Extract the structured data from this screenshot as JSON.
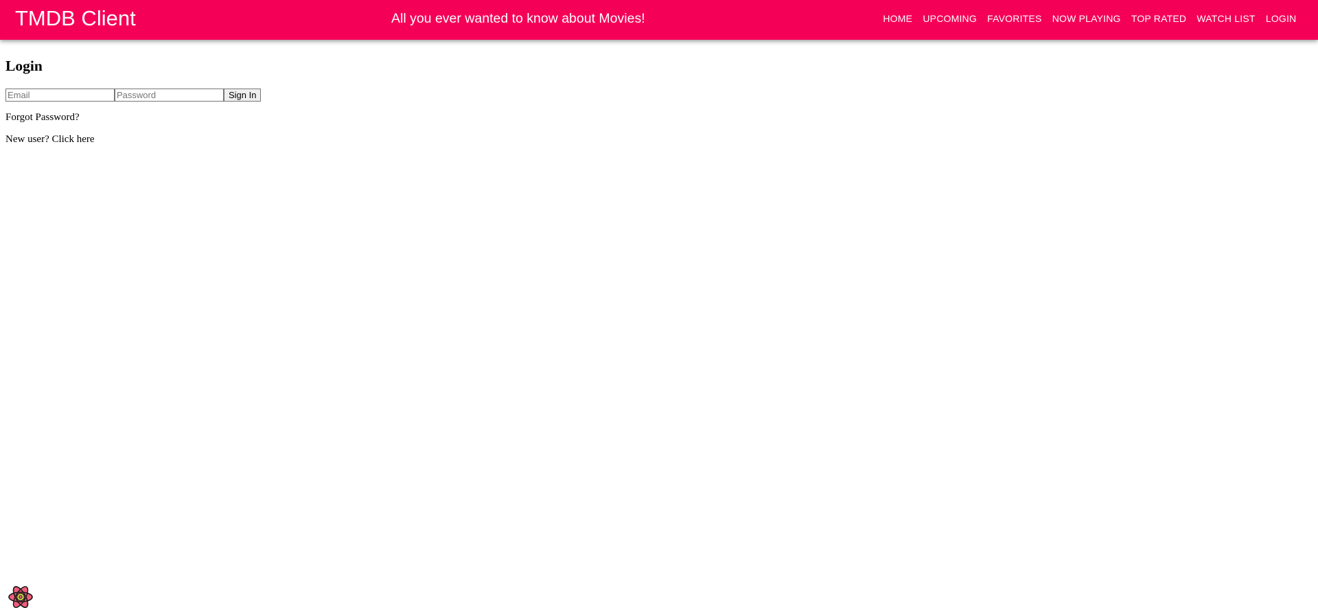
{
  "appbar": {
    "brand": "TMDB Client",
    "tagline": "All you ever wanted to know about Movies!",
    "background_color": "#f50057",
    "nav": [
      {
        "label": "HOME"
      },
      {
        "label": "UPCOMING"
      },
      {
        "label": "FAVORITES"
      },
      {
        "label": "NOW PLAYING"
      },
      {
        "label": "TOP RATED"
      },
      {
        "label": "WATCH LIST"
      },
      {
        "label": "LOGIN"
      }
    ]
  },
  "login": {
    "title": "Login",
    "email_placeholder": "Email",
    "password_placeholder": "Password",
    "sign_in_label": "Sign In",
    "forgot_password": "Forgot Password?",
    "new_user": "New user? Click here"
  },
  "footer": {
    "icon": "react-atom-icon"
  }
}
